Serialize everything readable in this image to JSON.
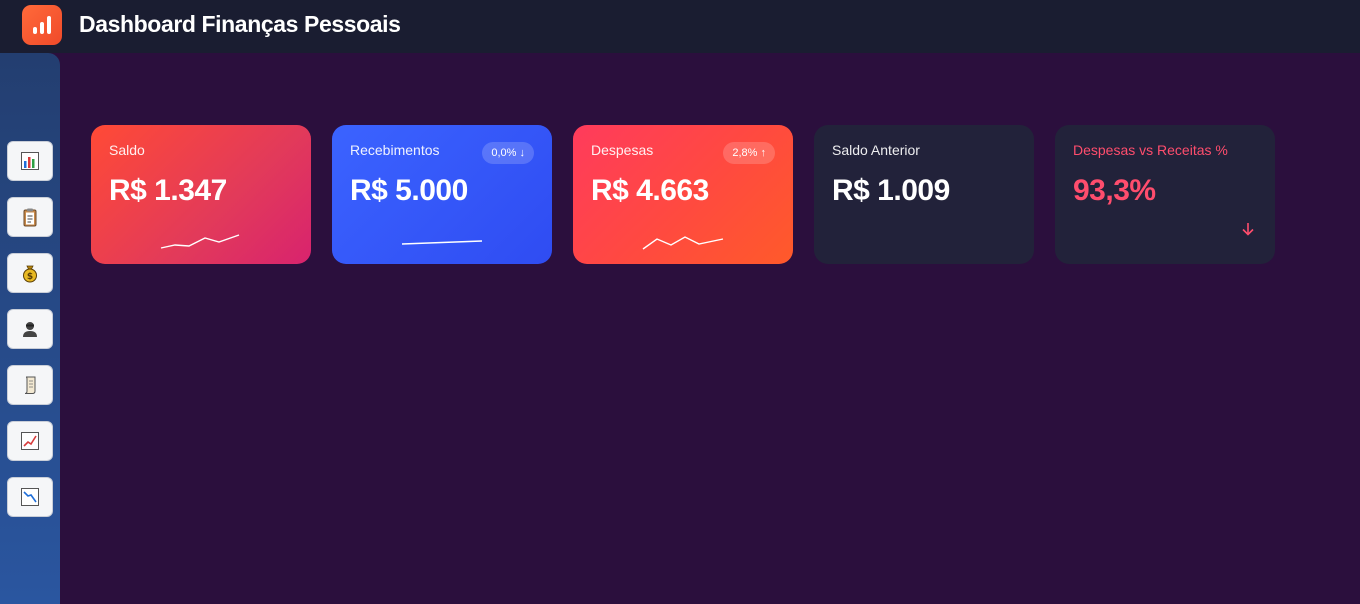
{
  "app": {
    "title": "Dashboard Finanças Pessoais"
  },
  "sidebar": {
    "items": [
      {
        "icon": "bar-chart-icon"
      },
      {
        "icon": "clipboard-icon"
      },
      {
        "icon": "money-bag-icon"
      },
      {
        "icon": "user-icon"
      },
      {
        "icon": "scroll-icon"
      },
      {
        "icon": "chart-increasing-icon"
      },
      {
        "icon": "chart-decreasing-icon"
      }
    ]
  },
  "cards": [
    {
      "label": "Saldo",
      "value": "R$ 1.347",
      "badge": "",
      "trend": "up"
    },
    {
      "label": "Recebimentos",
      "value": "R$ 5.000",
      "badge": "0,0% ↓",
      "trend": "flat"
    },
    {
      "label": "Despesas",
      "value": "R$ 4.663",
      "badge": "2,8% ↑",
      "trend": "zigzag"
    },
    {
      "label": "Saldo Anterior",
      "value": "R$ 1.009",
      "badge": "",
      "trend": "none"
    },
    {
      "label": "Despesas vs Receitas %",
      "value": "93,3%",
      "badge": "",
      "trend": "down"
    }
  ],
  "colors": {
    "background": "#2b0f3d",
    "topbar": "#1a1d31",
    "accent_red": "#ff4d6d",
    "card_dark": "#22223a"
  }
}
